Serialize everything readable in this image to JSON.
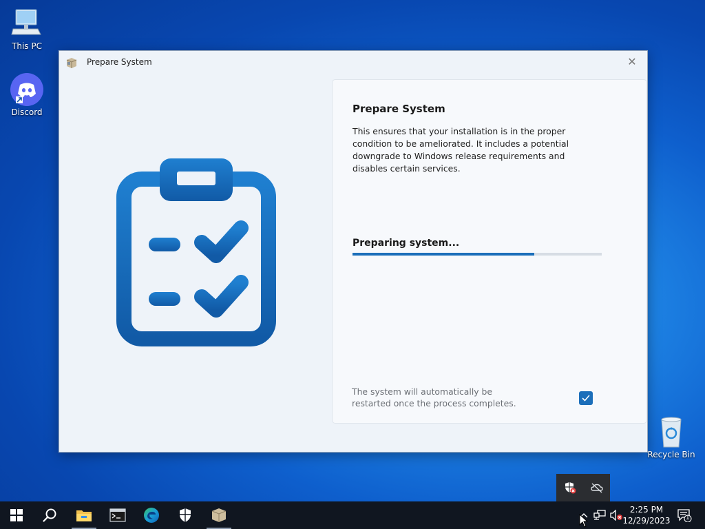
{
  "desktop": {
    "icons": [
      {
        "label": "This PC",
        "icon": "this-pc-icon"
      },
      {
        "label": "Discord",
        "icon": "discord-icon"
      },
      {
        "label": "Recycle Bin",
        "icon": "recycle-bin-icon"
      }
    ]
  },
  "window": {
    "title": "Prepare System",
    "close_glyph": "✕",
    "panel": {
      "heading": "Prepare System",
      "description": "This ensures that your installation is in the proper condition to be ameliorated. It includes a potential downgrade to Windows release requirements and disables certain services.",
      "status": "Preparing system...",
      "progress": 0.73,
      "restart_note": "The system will automatically be restarted once the process completes.",
      "restart_checked": true
    }
  },
  "taskbar": {
    "time": "2:25 PM",
    "date": "12/29/2023",
    "notification_count": "1",
    "pinned": [
      "start-icon",
      "search-icon",
      "file-explorer-icon",
      "terminal-icon",
      "edge-icon",
      "windows-security-icon",
      "package-icon"
    ]
  },
  "colors": {
    "accent": "#1c6fba",
    "taskbar": "#101620",
    "window_bg": "#eef3f9"
  }
}
